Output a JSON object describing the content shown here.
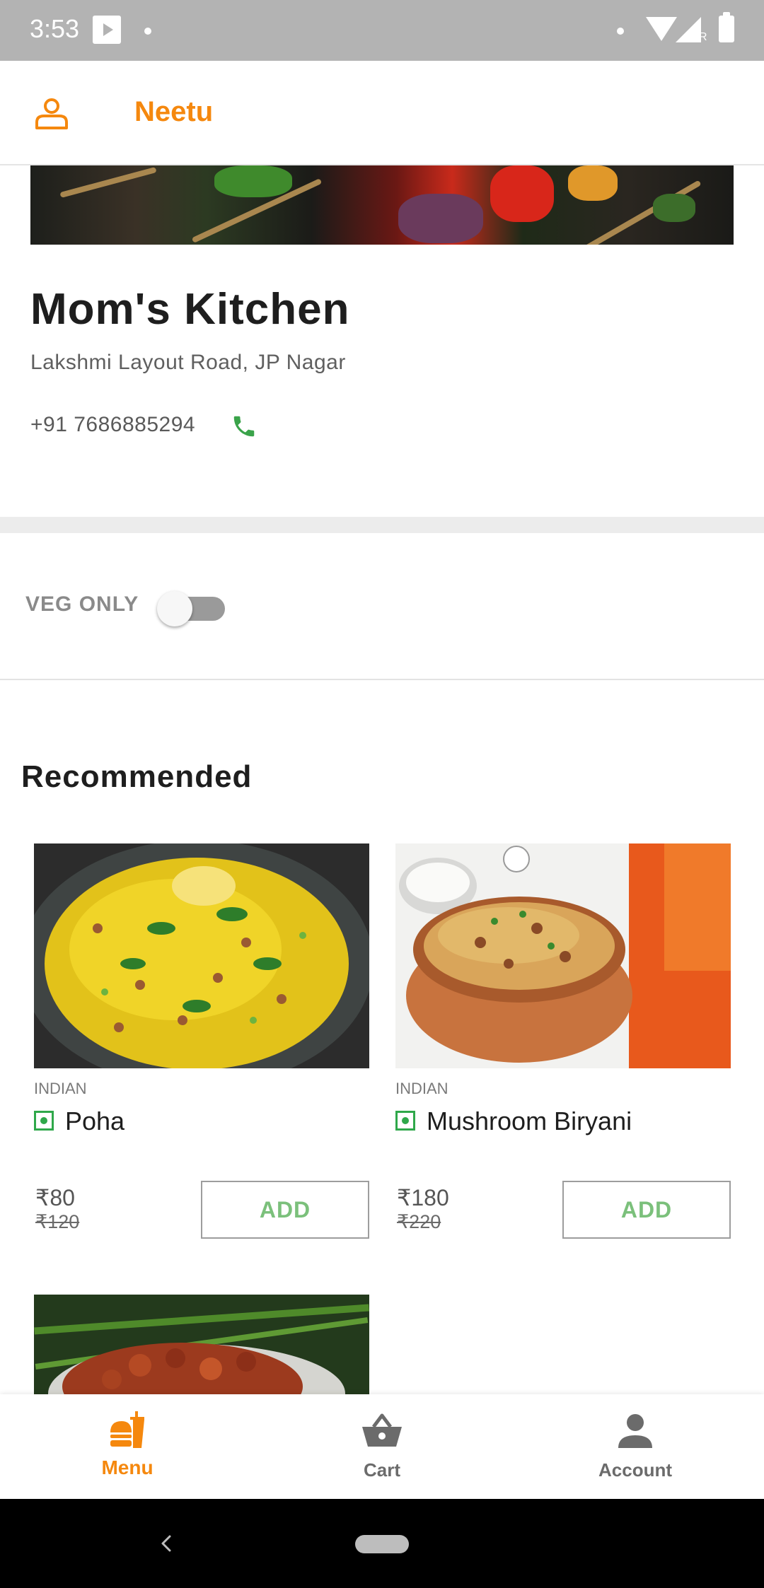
{
  "status_bar": {
    "time": "3:53",
    "network_indicator": "R"
  },
  "header": {
    "user_icon": "person-outline-icon",
    "user_name": "Neetu"
  },
  "restaurant": {
    "name": "Mom's Kitchen",
    "address": "Lakshmi Layout Road, JP Nagar",
    "phone": "+91 7686885294",
    "phone_icon": "phone-icon"
  },
  "filter": {
    "veg_only_label": "VEG ONLY",
    "veg_only_enabled": false
  },
  "recommended": {
    "title": "Recommended",
    "items": [
      {
        "cuisine": "INDIAN",
        "name": "Poha",
        "price": "₹80",
        "original_price": "₹120",
        "add_label": "ADD",
        "veg": true
      },
      {
        "cuisine": "INDIAN",
        "name": "Mushroom Biryani",
        "price": "₹180",
        "original_price": "₹220",
        "add_label": "ADD",
        "veg": true
      }
    ]
  },
  "bottom_nav": {
    "items": [
      {
        "label": "Menu",
        "icon": "burger-menu-icon",
        "active": true
      },
      {
        "label": "Cart",
        "icon": "basket-icon",
        "active": false
      },
      {
        "label": "Account",
        "icon": "account-icon",
        "active": false
      }
    ]
  },
  "colors": {
    "brand_orange": "#f5880e",
    "veg_green": "#2fa84a",
    "add_text_green": "#7bc07b",
    "phone_green": "#3aa34a",
    "inactive_nav": "#6b6b6b"
  }
}
